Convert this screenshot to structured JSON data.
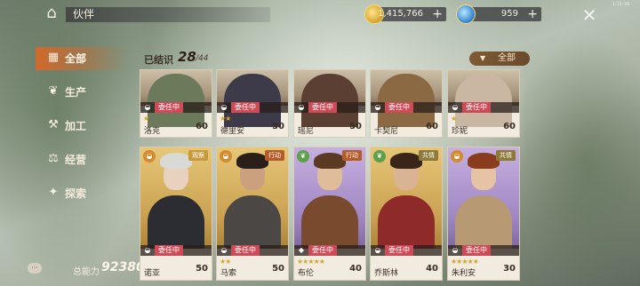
{
  "header": {
    "title": "伙伴",
    "gold_value": "1,415,766",
    "gem_value": "959",
    "plus_symbol": "+",
    "clock": "1:11:16"
  },
  "sidebar": {
    "items": [
      {
        "label": "全部",
        "icon": "grid-icon",
        "active": true
      },
      {
        "label": "生产",
        "icon": "sprout-icon",
        "active": false
      },
      {
        "label": "加工",
        "icon": "factory-icon",
        "active": false
      },
      {
        "label": "经营",
        "icon": "shop-icon",
        "active": false
      },
      {
        "label": "探索",
        "icon": "compass-icon",
        "active": false
      }
    ]
  },
  "footer": {
    "power_label": "总能力",
    "power_value": "92380"
  },
  "list": {
    "known_label": "已结识",
    "known_count": "28",
    "known_total": "/44",
    "filter_label": "全部",
    "status_label": "委任中"
  },
  "cards_row1": [
    {
      "name": "洛克",
      "level": "60",
      "stars": "★",
      "type_icon": "food-icon",
      "bg": "bg-neutral"
    },
    {
      "name": "德里安",
      "level": "50",
      "stars": "★★",
      "type_icon": "food-icon",
      "bg": "bg-neutral"
    },
    {
      "name": "瑶尼",
      "level": "50",
      "stars": "",
      "type_icon": "food-icon",
      "bg": "bg-neutral"
    },
    {
      "name": "卡契尼",
      "level": "60",
      "stars": "",
      "type_icon": "food-icon",
      "bg": "bg-neutral"
    },
    {
      "name": "珍妮",
      "level": "60",
      "stars": "★",
      "type_icon": "food-icon",
      "bg": "bg-neutral"
    }
  ],
  "cards_row2": [
    {
      "name": "诺亚",
      "level": "50",
      "stars": "",
      "tag": "观察",
      "tag_class": "tag-obs",
      "type_icon_class": "ti-food",
      "bg": "bg-gold",
      "hair": "#d9d9d6",
      "skin": "#e9d2bd",
      "body": "#2b2d33"
    },
    {
      "name": "马索",
      "level": "50",
      "stars": "★★",
      "tag": "行动",
      "tag_class": "tag-act",
      "type_icon_class": "ti-food",
      "bg": "bg-gold",
      "hair": "#2a1f18",
      "skin": "#caa07f",
      "body": "#4b4744"
    },
    {
      "name": "布伦",
      "level": "40",
      "stars": "★★★★★",
      "tag": "行动",
      "tag_class": "tag-act",
      "type_icon_class": "ti-leaf",
      "bg": "bg-purple",
      "hair": "#5a3a22",
      "skin": "#e0bc9b",
      "body": "#7a4a2e"
    },
    {
      "name": "乔斯林",
      "level": "40",
      "stars": "",
      "tag": "共情",
      "tag_class": "tag-coop",
      "type_icon_class": "ti-leaf",
      "bg": "bg-gold",
      "hair": "#3a2618",
      "skin": "#d9b394",
      "body": "#8e2a2a"
    },
    {
      "name": "朱利安",
      "level": "30",
      "stars": "★★★★★",
      "tag": "共情",
      "tag_class": "tag-coop",
      "type_icon_class": "ti-food",
      "bg": "bg-purple",
      "hair": "#8a3c1e",
      "skin": "#e6c3a5",
      "body": "#b79a73"
    }
  ]
}
